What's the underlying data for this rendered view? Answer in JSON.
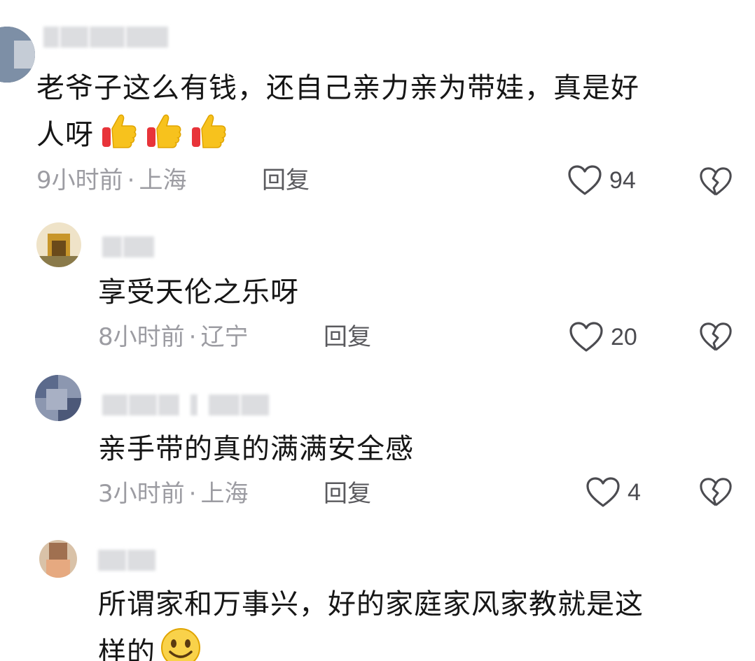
{
  "comments": [
    {
      "text_lines": [
        "老爷子这么有钱，还自己亲力亲为带娃，真是好",
        "人呀"
      ],
      "emojis": [
        "thumbs-up",
        "thumbs-up",
        "thumbs-up"
      ],
      "time": "9小时前",
      "location": "上海",
      "reply_label": "回复",
      "likes": "94"
    },
    {
      "text_lines": [
        "享受天伦之乐呀"
      ],
      "time": "8小时前",
      "location": "辽宁",
      "reply_label": "回复",
      "likes": "20"
    },
    {
      "text_lines": [
        "亲手带的真的满满安全感"
      ],
      "time": "3小时前",
      "location": "上海",
      "reply_label": "回复",
      "likes": "4"
    },
    {
      "text_lines": [
        "所谓家和万事兴，好的家庭家风家教就是这",
        "样的"
      ],
      "emojis": [
        "smiley"
      ]
    }
  ],
  "separator": "·",
  "colors": {
    "text": "#161616",
    "meta": "#9c9ca2",
    "icon": "#4b4b50",
    "thumb": "#f5c518"
  }
}
